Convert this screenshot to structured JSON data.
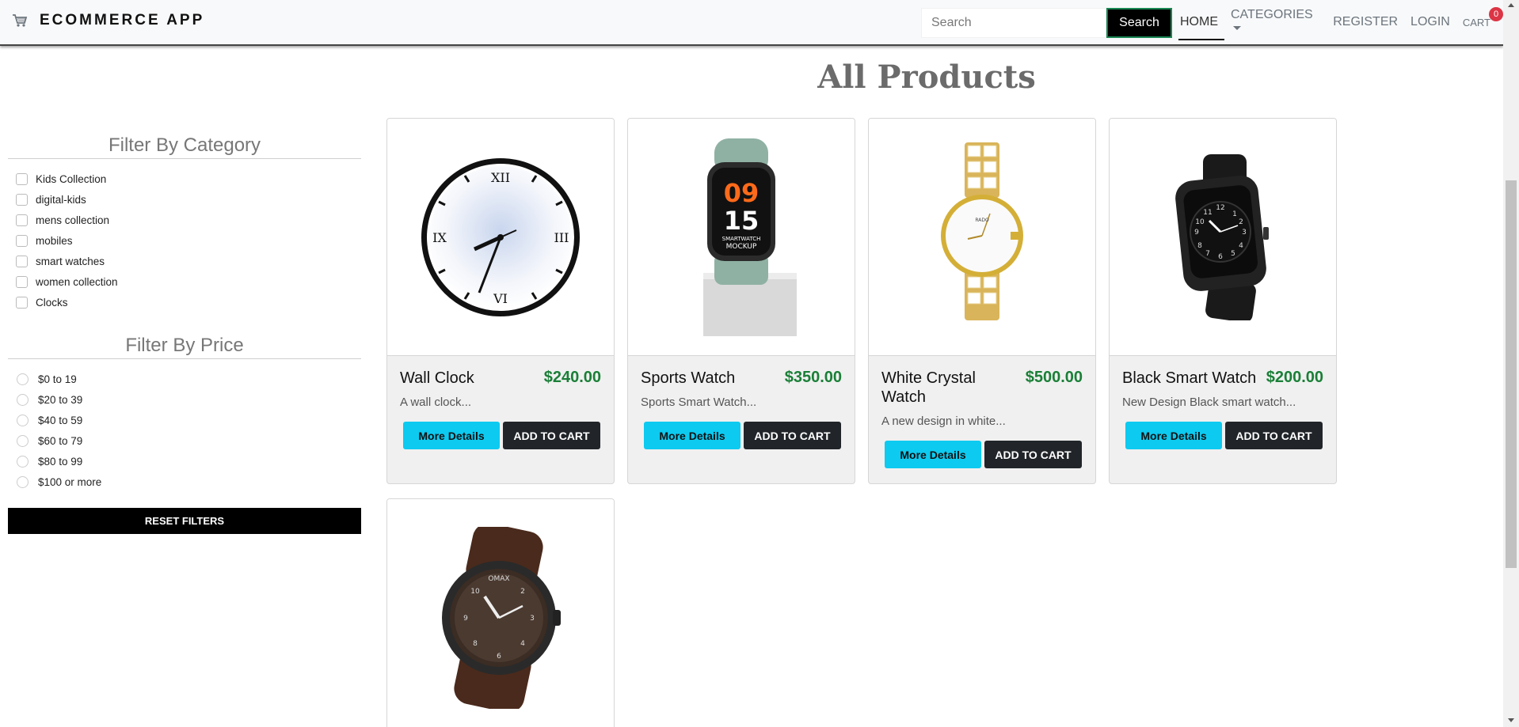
{
  "nav": {
    "brand": "ECOMMERCE APP",
    "brand_icon": "cart-icon",
    "search_placeholder": "Search",
    "search_button": "Search",
    "links": [
      "HOME",
      "CATEGORIES",
      "REGISTER",
      "LOGIN"
    ],
    "cart_label": "CART",
    "cart_count": "0"
  },
  "page_title": "All Products",
  "filters": {
    "category_title": "Filter By Category",
    "categories": [
      "Kids Collection",
      "digital-kids",
      "mens collection",
      "mobiles",
      "smart watches",
      "women collection",
      "Clocks"
    ],
    "price_title": "Filter By Price",
    "prices": [
      "$0 to 19",
      "$20 to 39",
      "$40 to 59",
      "$60 to 79",
      "$80 to 99",
      "$100 or more"
    ],
    "reset_label": "RESET FILTERS"
  },
  "products": [
    {
      "name": "Wall Clock",
      "price": "$240.00",
      "desc": "A wall clock...",
      "image": "wall-clock"
    },
    {
      "name": "Sports Watch",
      "price": "$350.00",
      "desc": "Sports Smart Watch...",
      "image": "sports-watch"
    },
    {
      "name": "White Crystal Watch",
      "price": "$500.00",
      "desc": "A new design in white...",
      "image": "white-crystal-watch"
    },
    {
      "name": "Black Smart Watch",
      "price": "$200.00",
      "desc": "New Design Black smart watch...",
      "image": "black-smart-watch"
    },
    {
      "name": "",
      "price": "",
      "desc": "",
      "image": "brown-watch"
    }
  ],
  "buttons": {
    "details": "More Details",
    "add_to_cart": "ADD TO CART"
  },
  "colors": {
    "price": "#1a7f37",
    "details_btn": "#0dcaf0",
    "cart_btn": "#212529",
    "badge": "#dc3545"
  }
}
